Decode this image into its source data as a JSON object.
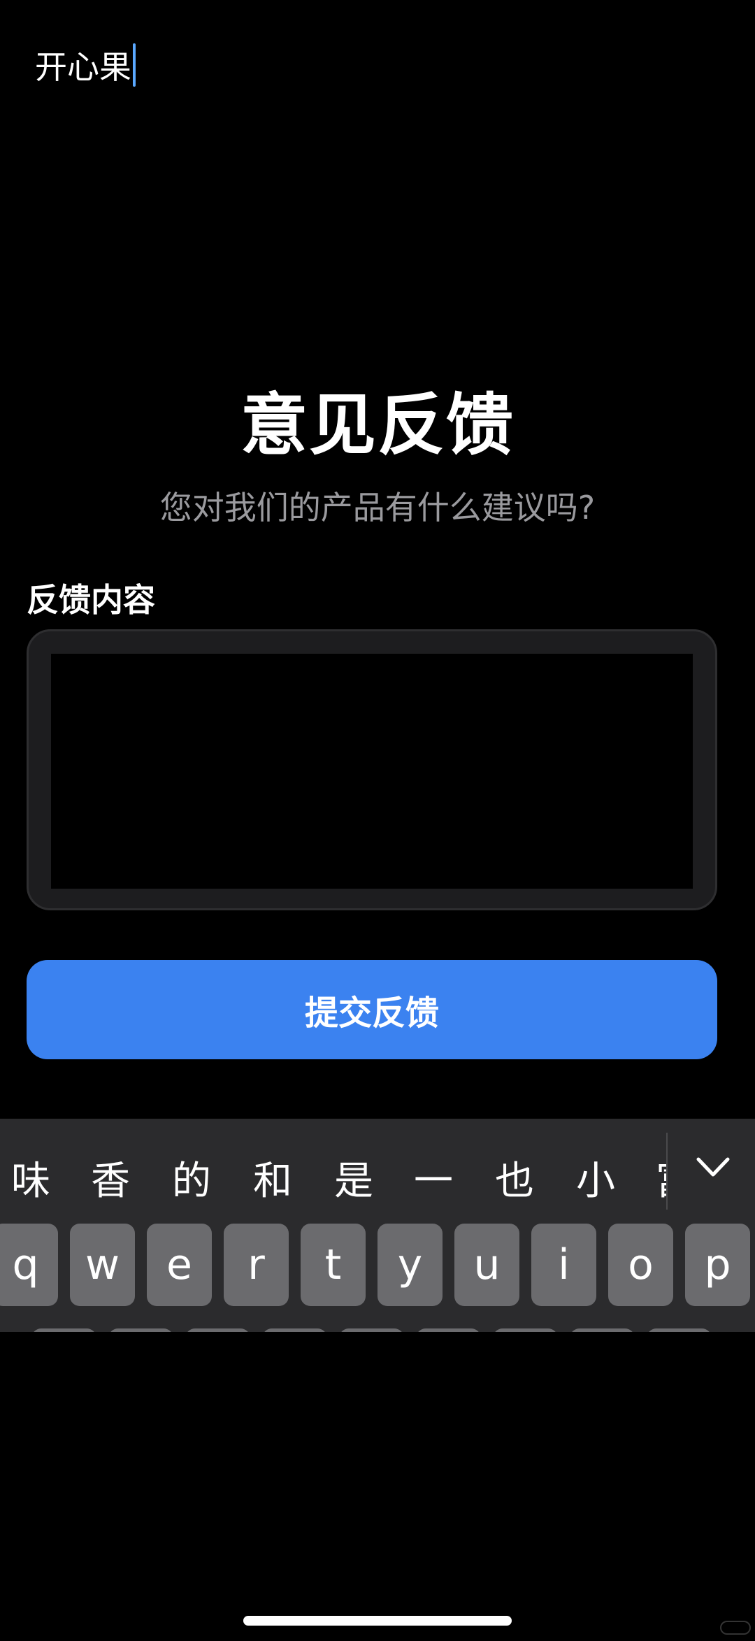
{
  "page": {
    "title": "意见反馈",
    "subtitle": "您对我们的产品有什么建议吗?"
  },
  "form": {
    "field_label": "反馈内容",
    "textarea_value": "开心果",
    "submit_label": "提交反馈"
  },
  "keyboard": {
    "candidates": [
      "味",
      "香",
      "的",
      "和",
      "是",
      "一",
      "也",
      "小",
      "富"
    ],
    "keys": [
      "q",
      "w",
      "e",
      "r",
      "t",
      "y",
      "u",
      "i",
      "o",
      "p"
    ]
  },
  "colors": {
    "background": "#000000",
    "accent": "#3b82f0",
    "caret": "#5aa8ff"
  }
}
